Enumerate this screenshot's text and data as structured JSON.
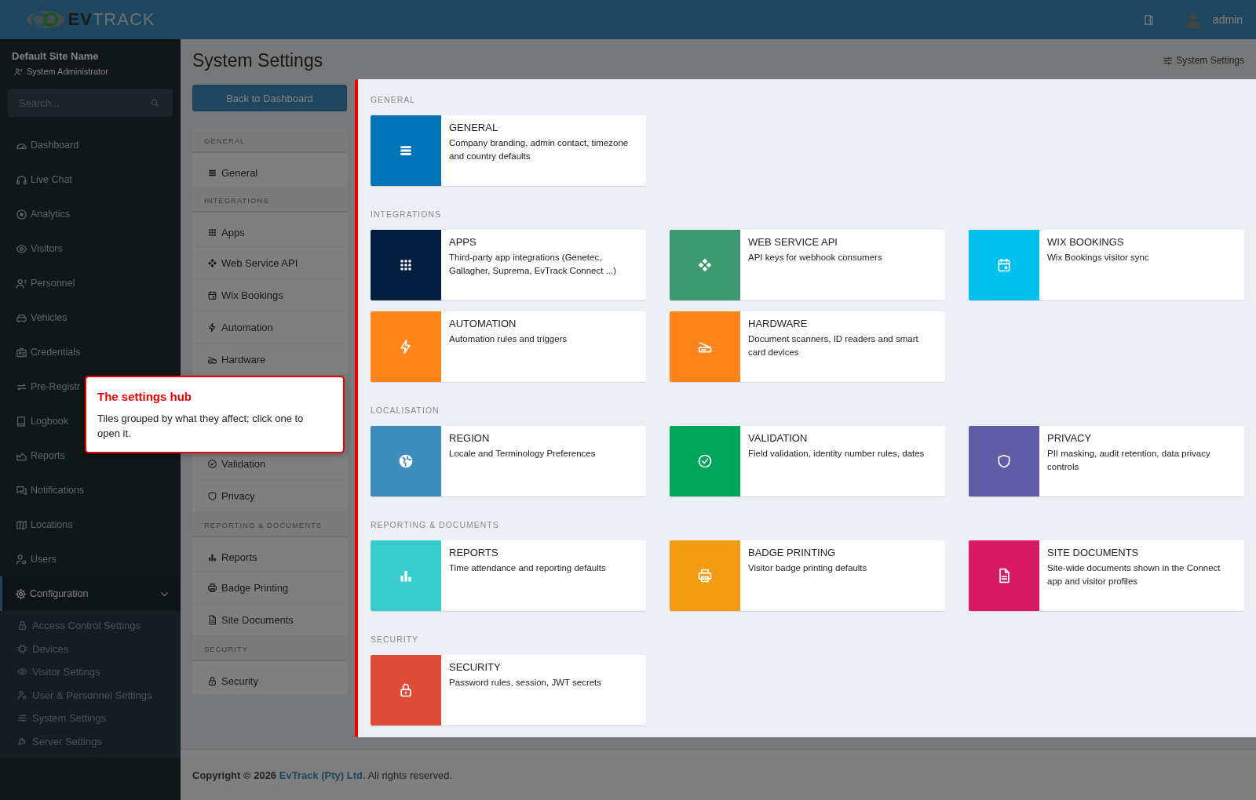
{
  "brand": {
    "logo_text": "**EV**TRACK"
  },
  "topbar": {
    "user": "admin"
  },
  "sidebar": {
    "site_name": "Default Site Name",
    "role": "System Administrator",
    "search": {
      "placeholder": "Search..."
    },
    "items": [
      {
        "label": "Dashboard",
        "kind": "gauge",
        "selected": false
      },
      {
        "label": "Live Chat",
        "kind": "headset",
        "selected": false
      },
      {
        "label": "Analytics",
        "kind": "target",
        "selected": false
      },
      {
        "label": "Visitors",
        "kind": "eye",
        "selected": false
      },
      {
        "label": "Personnel",
        "kind": "person",
        "selected": false
      },
      {
        "label": "Vehicles",
        "kind": "car",
        "selected": false
      },
      {
        "label": "Credentials",
        "kind": "idcard",
        "selected": false
      },
      {
        "label": "Pre-Registr",
        "kind": "arrows",
        "selected": false
      },
      {
        "label": "Logbook",
        "kind": "book",
        "selected": false
      },
      {
        "label": "Reports",
        "kind": "area",
        "selected": false
      },
      {
        "label": "Notifications",
        "kind": "chat",
        "selected": false
      },
      {
        "label": "Locations",
        "kind": "map",
        "selected": false
      },
      {
        "label": "Users",
        "kind": "usergear",
        "selected": false
      },
      {
        "label": "Configuration",
        "kind": "gear",
        "selected": true,
        "expanded": true,
        "children": [
          {
            "label": "Access Control Settings",
            "kind": "lock"
          },
          {
            "label": "Devices",
            "kind": "chip"
          },
          {
            "label": "Visitor Settings",
            "kind": "eye"
          },
          {
            "label": "User & Personnel Settings",
            "kind": "usergear"
          },
          {
            "label": "System Settings",
            "kind": "sliders"
          },
          {
            "label": "Server Settings",
            "kind": "wrench"
          }
        ]
      }
    ]
  },
  "page": {
    "title": "System Settings",
    "breadcrumb": "System Settings",
    "back_button": "Back to Dashboard"
  },
  "settings_menu": [
    {
      "title": "GENERAL",
      "items": [
        {
          "label": "General",
          "kind": "list"
        }
      ]
    },
    {
      "title": "INTEGRATIONS",
      "items": [
        {
          "label": "Apps",
          "kind": "grid"
        },
        {
          "label": "Web Service API",
          "kind": "diamond"
        },
        {
          "label": "Wix Bookings",
          "kind": "calendar"
        },
        {
          "label": "Automation",
          "kind": "bolt"
        },
        {
          "label": "Hardware",
          "kind": "scanner"
        }
      ]
    },
    {
      "items": [
        {
          "label": "Validation",
          "kind": "check"
        },
        {
          "label": "Privacy",
          "kind": "shield"
        }
      ]
    },
    {
      "title": "REPORTING & DOCUMENTS",
      "items": [
        {
          "label": "Reports",
          "kind": "bars"
        },
        {
          "label": "Badge Printing",
          "kind": "printer"
        },
        {
          "label": "Site Documents",
          "kind": "file"
        }
      ]
    },
    {
      "title": "SECURITY",
      "items": [
        {
          "label": "Security",
          "kind": "lock"
        }
      ]
    }
  ],
  "tile_sections": [
    {
      "title": "GENERAL",
      "tiles": [
        {
          "title": "GENERAL",
          "description": "Company branding, admin contact, timezone and country defaults",
          "kind": "list",
          "color": "#0073b7"
        }
      ]
    },
    {
      "title": "INTEGRATIONS",
      "tiles": [
        {
          "title": "APPS",
          "description": "Third-party app integrations (Genetec, Gallagher, Suprema, EvTrack Connect ...)",
          "kind": "grid",
          "color": "#001f3f"
        },
        {
          "title": "WEB SERVICE API",
          "description": "API keys for webhook consumers",
          "kind": "diamond",
          "color": "#3d9970"
        },
        {
          "title": "WIX BOOKINGS",
          "description": "Wix Bookings visitor sync",
          "kind": "calendar",
          "color": "#00c0ef"
        },
        {
          "title": "AUTOMATION",
          "description": "Automation rules and triggers",
          "kind": "bolt",
          "color": "#ff851b"
        },
        {
          "title": "HARDWARE",
          "description": "Document scanners, ID readers and smart card devices",
          "kind": "scanner",
          "color": "#ff851b"
        }
      ]
    },
    {
      "title": "LOCALISATION",
      "tiles": [
        {
          "title": "REGION",
          "description": "Locale and Terminology Preferences",
          "kind": "globe",
          "color": "#3c8dbc"
        },
        {
          "title": "VALIDATION",
          "description": "Field validation, identity number rules, dates",
          "kind": "check",
          "color": "#00a65a"
        },
        {
          "title": "PRIVACY",
          "description": "PII masking, audit retention, data privacy controls",
          "kind": "shield",
          "color": "#605ca8"
        }
      ]
    },
    {
      "title": "REPORTING & DOCUMENTS",
      "tiles": [
        {
          "title": "REPORTS",
          "description": "Time attendance and reporting defaults",
          "kind": "bars",
          "color": "#39cccc"
        },
        {
          "title": "BADGE PRINTING",
          "description": "Visitor badge printing defaults",
          "kind": "printer",
          "color": "#f39c12"
        },
        {
          "title": "SITE DOCUMENTS",
          "description": "Site-wide documents shown in the Connect app and visitor profiles",
          "kind": "file",
          "color": "#d81b60"
        }
      ]
    },
    {
      "title": "SECURITY",
      "tiles": [
        {
          "title": "SECURITY",
          "description": "Password rules, session, JWT secrets",
          "kind": "lock",
          "color": "#dd4b39"
        }
      ]
    }
  ],
  "tooltip": {
    "title": "The settings hub",
    "text": "Tiles grouped by what they affect; click one to open it."
  },
  "footer": {
    "prefix": "Copyright © 2026",
    "link": "EvTrack (Pty) Ltd.",
    "suffix": "All rights reserved."
  }
}
